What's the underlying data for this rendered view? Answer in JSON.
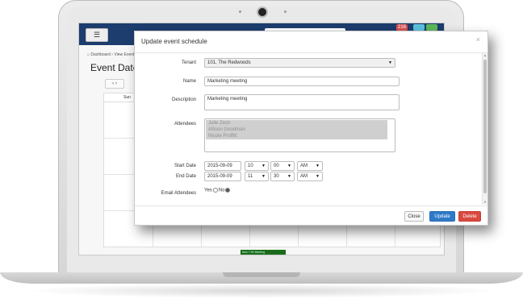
{
  "app": {
    "menu_icon": "hamburger-icon",
    "badges": [
      "216",
      "",
      ""
    ],
    "breadcrumb": [
      "Dashboard",
      "View Events"
    ],
    "page_title": "Event Date",
    "cal_nav": [
      "‹",
      "›"
    ],
    "weekday": "Sun",
    "event_chip": "Mon 7:00 Meeting"
  },
  "modal": {
    "title": "Update event schedule",
    "close_icon": "×",
    "fields": {
      "tenant_label": "Tenant",
      "tenant_value": "101, The Redwoods",
      "name_label": "Name",
      "name_value": "Marketing meeting",
      "description_label": "Description",
      "description_value": "Marketing meeting",
      "attendees_label": "Attendees",
      "attendees": [
        "Julie Zech",
        "Allison Goodman",
        "Nicole Proffitt"
      ],
      "start_label": "Start Date",
      "start_date": "2015-09-09",
      "start_hour": "10",
      "start_minute": "00",
      "start_ampm": "AM",
      "end_label": "End Date",
      "end_date": "2015-09-09",
      "end_hour": "11",
      "end_minute": "30",
      "end_ampm": "AM",
      "email_label": "Email Attendees",
      "yes_label": "Yes",
      "no_label": "No",
      "email_selected": "No"
    },
    "buttons": {
      "close": "Close",
      "update": "Update",
      "delete": "Delete"
    }
  },
  "colors": {
    "navbar": "#1d3d6e",
    "update_button": "#2f79c8",
    "delete_button": "#d9493f"
  }
}
